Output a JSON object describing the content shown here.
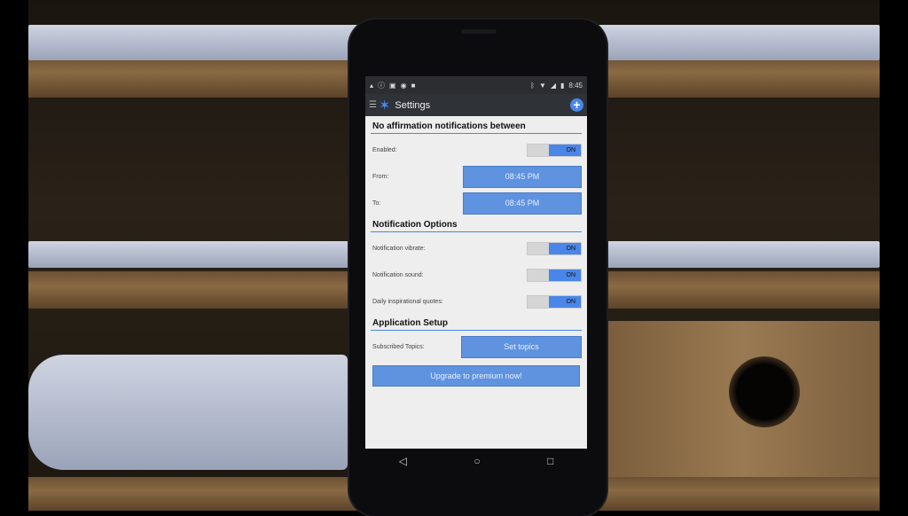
{
  "status_bar": {
    "time": "8:45"
  },
  "app_bar": {
    "title": "Settings"
  },
  "sections": {
    "quiet_hours": {
      "title": "No affirmation notifications between",
      "enabled_label": "Enabled:",
      "enabled_toggle": "ON",
      "from_label": "From:",
      "from_value": "08:45 PM",
      "to_label": "To:",
      "to_value": "08:45 PM"
    },
    "notification_options": {
      "title": "Notification Options",
      "vibrate_label": "Notification vibrate:",
      "vibrate_toggle": "ON",
      "sound_label": "Notification sound:",
      "sound_toggle": "ON",
      "quotes_label": "Daily inspirational quotes:",
      "quotes_toggle": "ON"
    },
    "application_setup": {
      "title": "Application Setup",
      "topics_label": "Subscribed Topics:",
      "topics_button": "Set topics",
      "premium_button": "Upgrade to premium now!"
    }
  },
  "icons": {
    "status_left": [
      "notification-icon",
      "info-icon",
      "lock-icon",
      "android-icon",
      "briefcase-icon"
    ],
    "status_right": [
      "bluetooth-icon",
      "wifi-icon",
      "signal-icon",
      "battery-icon"
    ],
    "nav": [
      "back-icon",
      "home-icon",
      "recents-icon"
    ]
  },
  "colors": {
    "accent": "#4a86e8",
    "toolbar": "#2f3237",
    "content_bg": "#eeeeee"
  }
}
